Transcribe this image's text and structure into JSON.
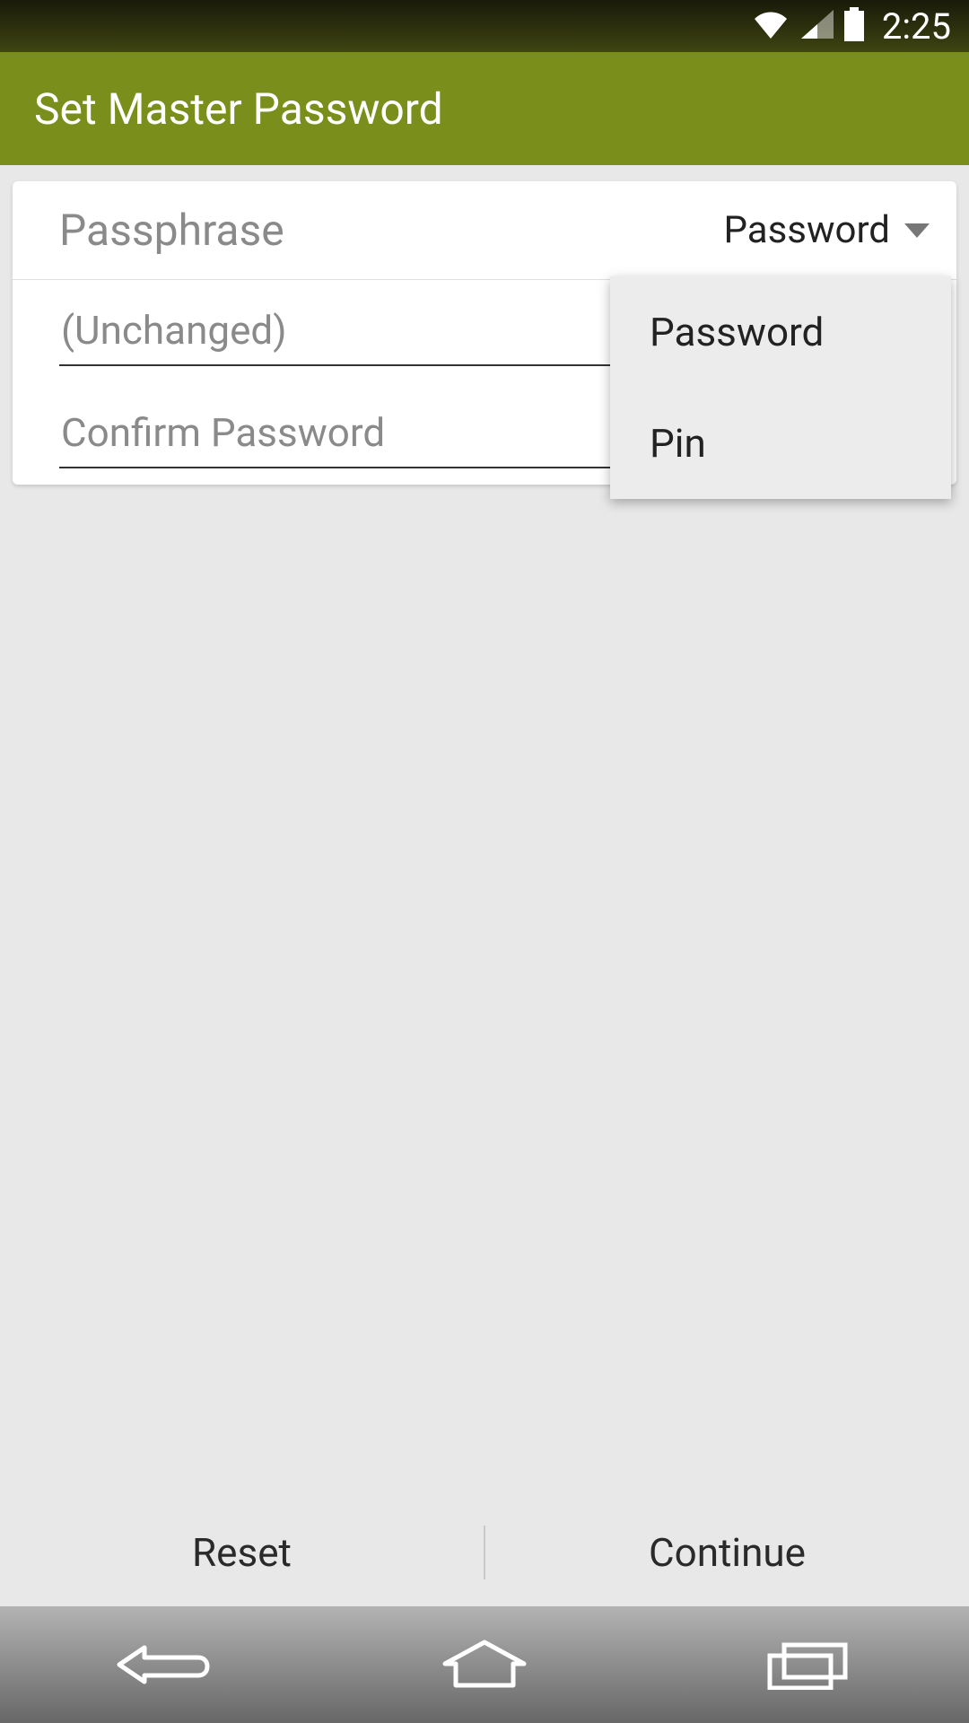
{
  "status_bar": {
    "time": "2:25"
  },
  "app_bar": {
    "title": "Set Master Password"
  },
  "form": {
    "passphrase_label": "Passphrase",
    "spinner_selected": "Password",
    "password_placeholder": "(Unchanged)",
    "password_value": "",
    "confirm_placeholder": "Confirm Password",
    "confirm_value": ""
  },
  "dropdown": {
    "options": [
      "Password",
      "Pin"
    ]
  },
  "footer": {
    "reset_label": "Reset",
    "continue_label": "Continue"
  }
}
